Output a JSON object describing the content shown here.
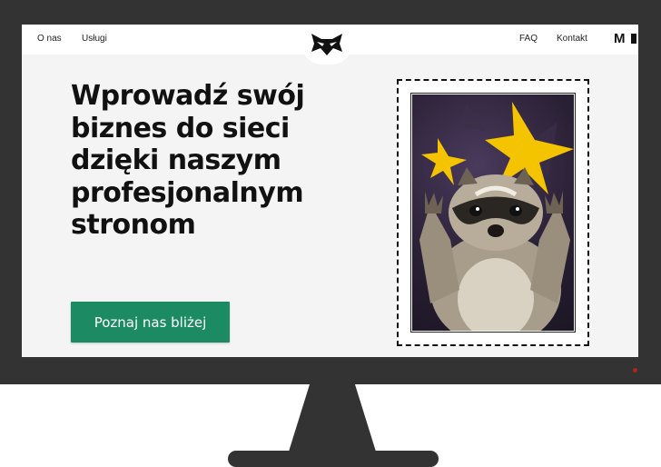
{
  "nav": {
    "left_links": [
      "O nas",
      "Usługi"
    ],
    "right_links": [
      "FAQ",
      "Kontakt"
    ],
    "brand_partial": "M"
  },
  "hero": {
    "heading": "Wprowadź swój biznes do sieci dzięki naszym profesjonalnym stronom",
    "cta_label": "Poznaj nas bliżej"
  },
  "image": {
    "description_icon": "raccoon-photo"
  },
  "colors": {
    "cta": "#1c8a62",
    "sparkle": "#f5c400",
    "monitor": "#333333",
    "screen_bg": "#f4f4f4"
  }
}
